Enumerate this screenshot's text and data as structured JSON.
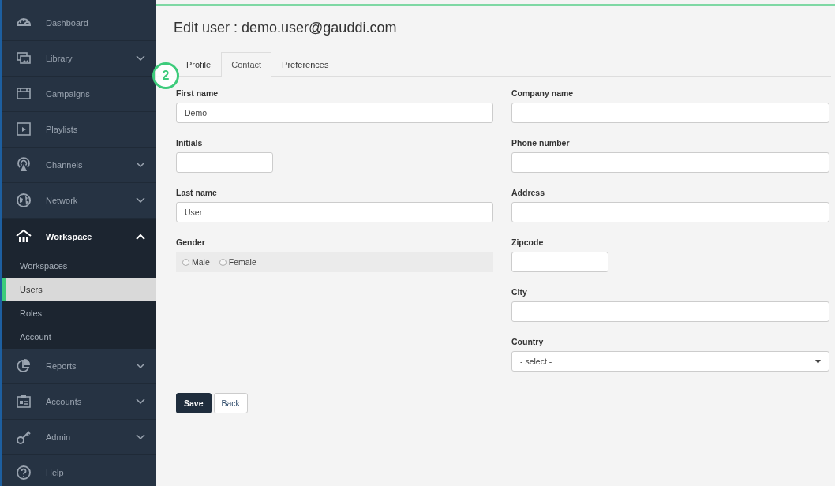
{
  "sidebar": {
    "items": [
      {
        "label": "Dashboard",
        "kind": "link"
      },
      {
        "label": "Library",
        "kind": "group",
        "expanded": false
      },
      {
        "label": "Campaigns",
        "kind": "link"
      },
      {
        "label": "Playlists",
        "kind": "link"
      },
      {
        "label": "Channels",
        "kind": "group",
        "expanded": false
      },
      {
        "label": "Network",
        "kind": "group",
        "expanded": false
      },
      {
        "label": "Workspace",
        "kind": "group",
        "expanded": true,
        "children": [
          {
            "label": "Workspaces",
            "selected": false
          },
          {
            "label": "Users",
            "selected": true
          },
          {
            "label": "Roles",
            "selected": false
          },
          {
            "label": "Account",
            "selected": false
          }
        ]
      },
      {
        "label": "Reports",
        "kind": "group",
        "expanded": false
      },
      {
        "label": "Accounts",
        "kind": "group",
        "expanded": false
      },
      {
        "label": "Admin",
        "kind": "group",
        "expanded": false
      },
      {
        "label": "Help",
        "kind": "link"
      }
    ]
  },
  "page_title": "Edit user : demo.user@gauddi.com",
  "tabs": [
    {
      "label": "Profile",
      "selected": false
    },
    {
      "label": "Contact",
      "selected": true
    },
    {
      "label": "Preferences",
      "selected": false
    }
  ],
  "annotation_badge": "2",
  "form": {
    "left_fields": [
      {
        "label": "First name",
        "kind": "text",
        "value": "Demo"
      },
      {
        "label": "Initials",
        "kind": "short"
      },
      {
        "label": "Last name",
        "kind": "text",
        "value": "User"
      },
      {
        "label": "Gender",
        "kind": "radio",
        "options": [
          {
            "label": "Male",
            "selected": false
          },
          {
            "label": "Female",
            "selected": false
          }
        ]
      }
    ],
    "right_fields": [
      {
        "label": "Company name",
        "kind": "text"
      },
      {
        "label": "Phone number",
        "kind": "text"
      },
      {
        "label": "Address",
        "kind": "text"
      },
      {
        "label": "Zipcode",
        "kind": "short"
      },
      {
        "label": "City",
        "kind": "text"
      },
      {
        "label": "Country",
        "kind": "select",
        "value": "- select -"
      }
    ]
  },
  "buttons": [
    {
      "label": "Save",
      "kind": "primary"
    },
    {
      "label": "Back",
      "kind": "default"
    }
  ]
}
